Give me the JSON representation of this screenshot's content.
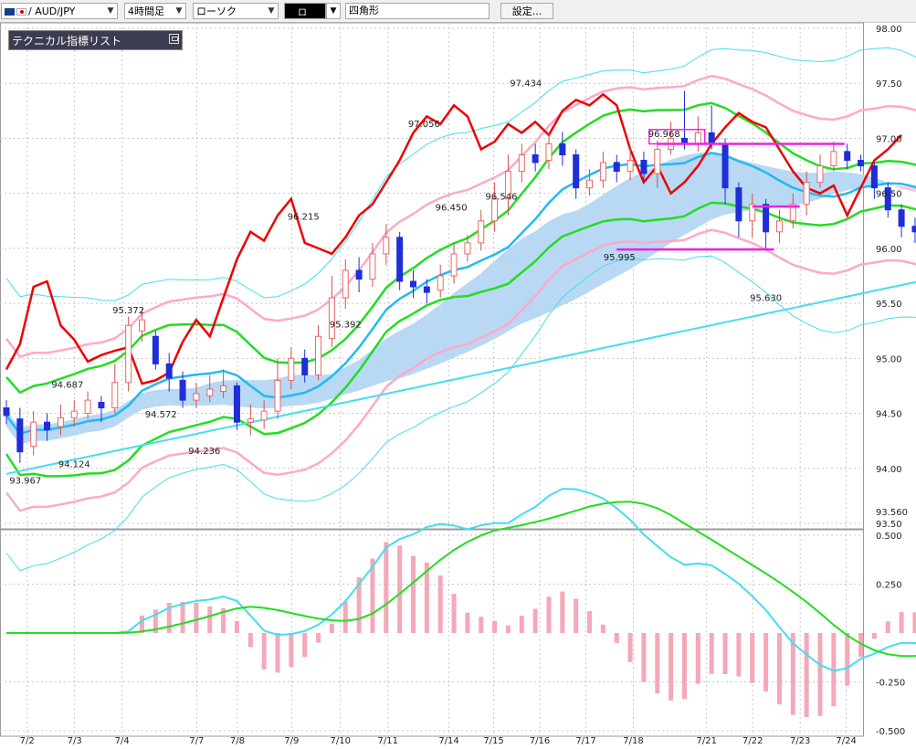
{
  "toolbar": {
    "symbol": "/ AUD/JPY",
    "timeframe": "4時間足",
    "chart_style": "ローソク",
    "color_label": "ロ",
    "drawing_tool": "四角形",
    "settings_label": "設定..."
  },
  "indicator_panel": {
    "title": "テクニカル指標リスト"
  },
  "colors": {
    "bull": "#ee6666",
    "bear": "#1f2ed8",
    "ma_red": "#ee0000",
    "green": "#22dd22",
    "cyan": "#22bbee",
    "light_cyan": "#44ddee",
    "pink": "#ffa8c8",
    "cloud": "#b8d8f4",
    "cloud_pink": "#f6c6dc",
    "magenta": "#ee22dd",
    "hist": "#f4a8b8"
  },
  "chart_data": {
    "type": "candlestick",
    "instrument": "AUD/JPY",
    "price_axis": {
      "ticks": [
        "98.00",
        "97.50",
        "97.00",
        "96.50",
        "96.00",
        "95.50",
        "95.00",
        "94.50",
        "94.00",
        "93.50"
      ],
      "range": [
        93.5,
        98.0
      ],
      "current_labels": [
        "93.560"
      ]
    },
    "macd_axis": {
      "ticks": [
        "0.500",
        "0.250",
        "-0.250",
        "-0.500"
      ],
      "range": [
        -0.5,
        0.5
      ]
    },
    "x_labels": [
      "7/2",
      "7/3",
      "7/4",
      "7/7",
      "7/8",
      "7/9",
      "7/10",
      "7/11",
      "7/14",
      "7/15",
      "7/16",
      "7/17",
      "7/18",
      "7/21",
      "7/22",
      "7/23",
      "7/24"
    ],
    "x_label_pos": [
      1.8,
      5.3,
      8.8,
      14.3,
      17.3,
      21.3,
      24.9,
      28.4,
      32.9,
      36.2,
      39.6,
      43.0,
      46.5,
      51.9,
      55.3,
      58.8,
      62.2
    ],
    "annotations": [
      {
        "text": "93.967",
        "i": 1.4,
        "v": 93.97,
        "pos": "below"
      },
      {
        "text": "94.124",
        "i": 5.0,
        "v": 94.12,
        "pos": "below"
      },
      {
        "text": "94.687",
        "i": 4.5,
        "v": 94.69,
        "pos": "above"
      },
      {
        "text": "95.372",
        "i": 9.0,
        "v": 95.37,
        "pos": "above"
      },
      {
        "text": "94.572",
        "i": 11.4,
        "v": 94.57,
        "pos": "below"
      },
      {
        "text": "94.236",
        "i": 14.6,
        "v": 94.24,
        "pos": "below"
      },
      {
        "text": "96.215",
        "i": 21.9,
        "v": 96.22,
        "pos": "above"
      },
      {
        "text": "95.392",
        "i": 25.0,
        "v": 95.39,
        "pos": "below"
      },
      {
        "text": "97.056",
        "i": 30.8,
        "v": 97.06,
        "pos": "above"
      },
      {
        "text": "96.450",
        "i": 32.8,
        "v": 96.45,
        "pos": "below"
      },
      {
        "text": "96.546",
        "i": 36.5,
        "v": 96.55,
        "pos": "below"
      },
      {
        "text": "97.434",
        "i": 38.3,
        "v": 97.43,
        "pos": "above"
      },
      {
        "text": "96.968",
        "i": 48.5,
        "v": 96.97,
        "pos": "above",
        "boxed": true
      },
      {
        "text": "95.995",
        "i": 45.2,
        "v": 96.0,
        "pos": "below"
      },
      {
        "text": "95.630",
        "i": 56.0,
        "v": 95.63,
        "pos": "below"
      }
    ],
    "candles": [
      [
        94.55,
        94.48,
        94.62,
        94.4
      ],
      [
        94.45,
        94.15,
        94.55,
        94.05
      ],
      [
        94.2,
        94.42,
        94.52,
        94.12
      ],
      [
        94.42,
        94.35,
        94.5,
        94.25
      ],
      [
        94.38,
        94.46,
        94.58,
        94.3
      ],
      [
        94.46,
        94.52,
        94.62,
        94.38
      ],
      [
        94.5,
        94.62,
        94.7,
        94.45
      ],
      [
        94.6,
        94.55,
        94.66,
        94.42
      ],
      [
        94.55,
        94.78,
        94.95,
        94.5
      ],
      [
        94.78,
        95.3,
        95.38,
        94.7
      ],
      [
        95.25,
        95.35,
        95.45,
        95.15
      ],
      [
        95.2,
        94.95,
        95.25,
        94.9
      ],
      [
        94.95,
        94.82,
        95.05,
        94.7
      ],
      [
        94.8,
        94.62,
        94.88,
        94.55
      ],
      [
        94.62,
        94.68,
        94.78,
        94.55
      ],
      [
        94.66,
        94.72,
        94.85,
        94.6
      ],
      [
        94.7,
        94.75,
        94.9,
        94.64
      ],
      [
        94.75,
        94.42,
        94.78,
        94.35
      ],
      [
        94.42,
        94.45,
        94.58,
        94.3
      ],
      [
        94.44,
        94.52,
        94.62,
        94.36
      ],
      [
        94.52,
        94.8,
        95.0,
        94.45
      ],
      [
        94.8,
        95.0,
        95.1,
        94.72
      ],
      [
        95.0,
        94.85,
        95.08,
        94.78
      ],
      [
        94.85,
        95.2,
        95.3,
        94.8
      ],
      [
        95.18,
        95.55,
        95.75,
        95.1
      ],
      [
        95.55,
        95.8,
        95.9,
        95.45
      ],
      [
        95.8,
        95.72,
        95.92,
        95.6
      ],
      [
        95.72,
        95.95,
        96.05,
        95.65
      ],
      [
        95.95,
        96.1,
        96.22,
        95.85
      ],
      [
        96.1,
        95.7,
        96.15,
        95.62
      ],
      [
        95.7,
        95.65,
        95.8,
        95.55
      ],
      [
        95.65,
        95.6,
        95.72,
        95.5
      ],
      [
        95.62,
        95.75,
        95.85,
        95.55
      ],
      [
        95.75,
        95.95,
        96.05,
        95.68
      ],
      [
        95.95,
        96.05,
        96.12,
        95.88
      ],
      [
        96.05,
        96.25,
        96.35,
        95.98
      ],
      [
        96.25,
        96.45,
        96.6,
        96.15
      ],
      [
        96.45,
        96.7,
        96.85,
        96.3
      ],
      [
        96.7,
        96.85,
        96.95,
        96.6
      ],
      [
        96.85,
        96.78,
        96.95,
        96.7
      ],
      [
        96.8,
        96.95,
        97.05,
        96.72
      ],
      [
        96.95,
        96.85,
        97.06,
        96.75
      ],
      [
        96.85,
        96.55,
        96.9,
        96.45
      ],
      [
        96.55,
        96.62,
        96.72,
        96.48
      ],
      [
        96.62,
        96.78,
        96.88,
        96.55
      ],
      [
        96.78,
        96.7,
        96.85,
        96.6
      ],
      [
        96.7,
        96.8,
        96.92,
        96.62
      ],
      [
        96.8,
        96.68,
        96.88,
        96.6
      ],
      [
        96.68,
        96.9,
        96.98,
        96.55
      ],
      [
        96.9,
        97.0,
        97.15,
        96.85
      ],
      [
        97.0,
        96.95,
        97.43,
        96.9
      ],
      [
        96.95,
        97.05,
        97.2,
        96.88
      ],
      [
        97.05,
        96.95,
        97.3,
        96.9
      ],
      [
        96.95,
        96.55,
        97.0,
        96.4
      ],
      [
        96.55,
        96.25,
        96.6,
        96.1
      ],
      [
        96.25,
        96.4,
        96.5,
        96.1
      ],
      [
        96.4,
        96.15,
        96.45,
        95.99
      ],
      [
        96.15,
        96.25,
        96.35,
        96.05
      ],
      [
        96.25,
        96.4,
        96.5,
        96.18
      ],
      [
        96.4,
        96.6,
        96.7,
        96.3
      ],
      [
        96.6,
        96.75,
        96.85,
        96.55
      ],
      [
        96.75,
        96.88,
        96.97,
        96.7
      ],
      [
        96.88,
        96.8,
        96.95,
        96.72
      ],
      [
        96.8,
        96.75,
        96.85,
        96.7
      ],
      [
        96.75,
        96.55,
        96.78,
        96.45
      ],
      [
        96.55,
        96.35,
        96.6,
        96.28
      ],
      [
        96.35,
        96.2,
        96.4,
        96.1
      ],
      [
        96.2,
        96.15,
        96.28,
        96.05
      ],
      [
        96.15,
        96.22,
        96.35,
        96.08
      ],
      [
        96.22,
        95.95,
        96.3,
        95.63
      ],
      [
        95.95,
        96.2,
        96.25,
        95.85
      ],
      [
        96.2,
        96.45,
        96.6,
        96.15
      ],
      [
        96.45,
        96.55,
        96.65,
        96.4
      ],
      [
        96.55,
        96.68,
        96.75,
        96.5
      ]
    ],
    "macd_histogram_range": [
      -0.3,
      0.2
    ]
  }
}
